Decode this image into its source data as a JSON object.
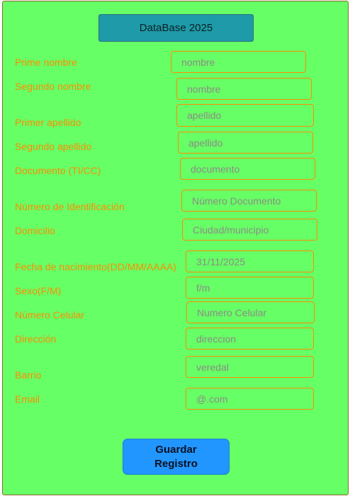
{
  "header": {
    "title": "DataBase 2025"
  },
  "form": {
    "fields": [
      {
        "label": "Prime nombre",
        "placeholder": "nombre"
      },
      {
        "label": "Segundo nombre",
        "placeholder": "nombre"
      },
      {
        "label": "Primer apellido",
        "placeholder": "apellido"
      },
      {
        "label": "Segundo apellido",
        "placeholder": "apellido"
      },
      {
        "label": "Documento (TI/CC)",
        "placeholder": "documento"
      },
      {
        "label": "Número de Identificación",
        "placeholder": "Número Documento"
      },
      {
        "label": "Domicilio",
        "placeholder": "Ciudad/municipio"
      },
      {
        "label": "Fecha de nacimiento(DD/MM/AAAA)",
        "placeholder": "31/11/2025"
      },
      {
        "label": "Sexo(F/M)",
        "placeholder": "f/m"
      },
      {
        "label": "Número Celular",
        "placeholder": "Numero Celular"
      },
      {
        "label": "Dirección",
        "placeholder": "direccion"
      },
      {
        "label": "Barrio",
        "placeholder": "veredal"
      },
      {
        "label": "Email",
        "placeholder": "@.com"
      }
    ],
    "submit_label": "Guardar Registro"
  },
  "colors": {
    "background": "#66ff66",
    "label_text": "#ff8c00",
    "field_border": "#ff8c00",
    "title_button": "#1f9aa8",
    "submit_button": "#2196ff"
  }
}
